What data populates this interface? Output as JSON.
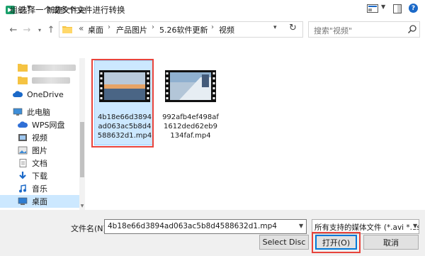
{
  "window": {
    "title": "选择一个或多个文件进行转换",
    "close_glyph": "✕"
  },
  "address": {
    "prefix": "«",
    "crumbs": [
      "桌面",
      "产品图片",
      "5.26软件更新",
      "视频"
    ],
    "separator": "›"
  },
  "search": {
    "placeholder": "搜索\"视频\""
  },
  "toolbar": {
    "organize_label": "组织",
    "new_folder_label": "新建文件夹"
  },
  "sidebar": {
    "items": [
      {
        "label": "OneDrive",
        "icon": "cloud-icon"
      },
      {
        "label": "此电脑",
        "icon": "computer-icon"
      },
      {
        "label": "WPS网盘",
        "icon": "cloud-drive-icon"
      },
      {
        "label": "视频",
        "icon": "video-folder-icon"
      },
      {
        "label": "图片",
        "icon": "pictures-icon"
      },
      {
        "label": "文档",
        "icon": "documents-icon"
      },
      {
        "label": "下载",
        "icon": "download-icon"
      },
      {
        "label": "音乐",
        "icon": "music-icon"
      },
      {
        "label": "桌面",
        "icon": "desktop-icon",
        "selected": true
      }
    ]
  },
  "files": [
    {
      "name": "4b18e66d3894ad063ac5b8d4588632d1.mp4",
      "display": "4b18e66d3894\nad063ac5b8d4\n588632d1.mp4",
      "selected": true
    },
    {
      "name": "992afb4ef498af1612ded62eb9134faf.mp4",
      "display": "992afb4ef498af\n1612ded62eb9\n134faf.mp4",
      "selected": false
    }
  ],
  "bottom": {
    "filename_label": "文件名(N):",
    "filename_value": "4b18e66d3894ad063ac5b8d4588632d1.mp4",
    "filter_value": "所有支持的媒体文件 (*.avi *.asf",
    "select_disc_label": "Select Disc",
    "open_label": "打开(O)",
    "cancel_label": "取消"
  },
  "colors": {
    "accent": "#0078d7",
    "selection_bg": "#cce8ff",
    "annotation_red": "#e8443c",
    "folder_yellow": "#f5c342"
  }
}
